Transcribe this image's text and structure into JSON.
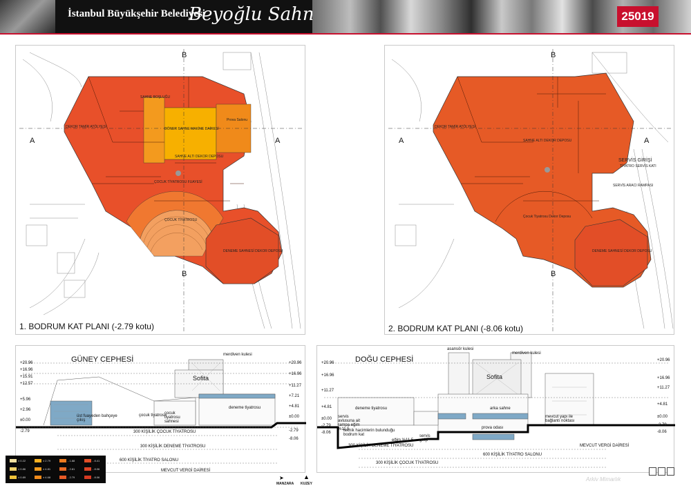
{
  "header": {
    "org": "İstanbul Büyükşehir Belediyesi",
    "project": "Beyoğlu Sahnesi",
    "code": "25019"
  },
  "plan1": {
    "title": "1. BODRUM KAT PLANI (-2.79 kotu)",
    "section_a": "A",
    "section_b": "B",
    "rooms": {
      "dekor_atolye": "DEKOR TAMİR ATÖLYESİ",
      "sahne_bos": "SAHNE BOŞLUĞU",
      "donen_sahne": "DÖNER SAHNE MAKİNE DAİRESİ",
      "sahne_alti": "SAHNE ALTI DEKOR DEPOSU",
      "cocuk_fuaye": "ÇOCUK TİYATROSU FUAYESİ",
      "cocuk_tiyatro": "ÇOCUK TİYATROSU",
      "deneme_sahnesi": "DENEME SAHNESİ DEKOR DEPOSU",
      "prova": "Prova Salonu"
    }
  },
  "plan2": {
    "title": "2. BODRUM KAT PLANI (-8.06 kotu)",
    "section_a": "A",
    "section_b": "B",
    "rooms": {
      "dekor_atolye": "DEKOR TAMİR ATÖLYESİ",
      "sahne_dekor": "SAHNE ALTI DEKOR DEPOSU",
      "servis": "SERVİS GİRİŞİ",
      "tiyatro_servis": "TİYATRO SERVİS KATI",
      "cocuk": "Çocuk Tiyatrosu Dekor Deposu",
      "deneme": "DENEME SAHNESİ DEKOR DEPOSU",
      "servis_rampa": "SERVİS ARACI RAMPASI"
    }
  },
  "guney": {
    "title": "GÜNEY CEPHESİ",
    "sofita": "Sofita",
    "merdiven": "merdiven kulesi",
    "deneme": "deneme tiyatrosu",
    "cocuk": "çocuk tiyatrosu",
    "cocuk_sahne": "çocuk tiyatrosu sahnesi",
    "fuaye": "üst fuayeden bahçeye çıkış",
    "s1": "300 KİŞİLİK ÇOCUK TİYATROSU",
    "s2": "300 KİŞİLİK DENEME TİYATROSU",
    "s3": "600 KİŞİLİK TİYATRO SALONU",
    "s4": "MEVCUT VERGİ DAİRESİ",
    "levels": [
      "+20.96",
      "+16.96",
      "+15.91",
      "+12.57",
      "+5.96",
      "+2.96",
      "±0.00",
      "-2.79"
    ],
    "levels_right": [
      "+20.96",
      "+16.96",
      "+11.27",
      "+7.21",
      "+4.81",
      "±0.00",
      "-2.79",
      "-8.06"
    ]
  },
  "dogu": {
    "title": "DOĞU CEPHESİ",
    "sofita": "Sofita",
    "asansor": "asansör kulesi",
    "merdiven": "merdiven kulesi",
    "deneme": "deneme tiyatrosu",
    "arka": "arka sahne",
    "prova": "prova odası",
    "teknik": "teknik hacimlerin bulunduğu bodrum kat",
    "servis": "servis girişi",
    "servis_rampa": "servis avlusuna ait rampa eğim %11.5",
    "egim": "eğim %11.5",
    "mevcut": "mevcut yapı ile bağlantı noktası",
    "s1": "300 KİŞİLİK DENEME TİYATROSU",
    "s2": "600 KİŞİLİK TİYATRO SALONU",
    "s3": "300 KİŞİLİK ÇOCUK TİYATROSU",
    "s4": "MEVCUT VERGİ DAİRESİ",
    "levels": [
      "+20.96",
      "+16.96",
      "+11.27",
      "+4.81",
      "±0.00",
      "-2.79",
      "-8.06"
    ],
    "levels_right": [
      "+20.96",
      "+16.96",
      "+11.27",
      "+4.81",
      "±0.00",
      "-2.79",
      "-8.06"
    ]
  },
  "legend": [
    {
      "label": "± 0.22",
      "color": "#f3e2a0"
    },
    {
      "label": "± 0.86",
      "color": "#f2d36b"
    },
    {
      "label": "± 0.89",
      "color": "#efc23a"
    },
    {
      "label": "± 2.79",
      "color": "#f5b021"
    },
    {
      "label": "± 4.81",
      "color": "#f39a1e"
    },
    {
      "label": "± 4.68",
      "color": "#f08a1a"
    },
    {
      "label": "- 1.88",
      "color": "#ed7a1f"
    },
    {
      "label": "- 2.81",
      "color": "#e96a24"
    },
    {
      "label": "- 2.79",
      "color": "#e65a26"
    },
    {
      "label": "- 8.41",
      "color": "#e24e27"
    },
    {
      "label": "- 8.06",
      "color": "#dd4426"
    },
    {
      "label": "- 8.06",
      "color": "#d63a22"
    }
  ],
  "nav": {
    "manzara": "MANZARA",
    "kuzey": "KUZEY"
  },
  "footer": {
    "site": "Arkiv Mimarlık"
  },
  "colors": {
    "accent": "#c8102e",
    "plan": "#e8502a",
    "plan_light": "#f07830",
    "plan_yellow": "#f7b000"
  }
}
